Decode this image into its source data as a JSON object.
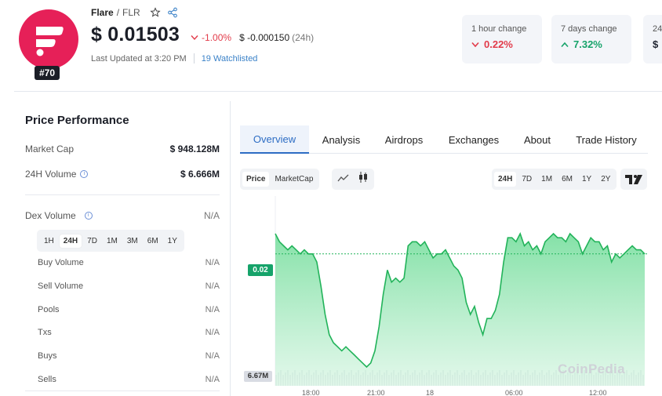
{
  "coin": {
    "name": "Flare",
    "separator": "/",
    "symbol": "FLR",
    "rank": "#70",
    "price": "$ 0.01503",
    "percent_change": "-1.00%",
    "abs_change": "$ -0.000150",
    "abs_change_period": "(24h)",
    "last_updated": "Last Updated at 3:20 PM",
    "watchlisted": "19 Watchlisted",
    "brand_color": "#e62058"
  },
  "stat_cards": [
    {
      "label": "1 hour change",
      "value": "0.22%",
      "direction": "down"
    },
    {
      "label": "7 days change",
      "value": "7.32%",
      "direction": "up"
    },
    {
      "label": "24",
      "value": "$",
      "direction": "none"
    }
  ],
  "performance": {
    "title": "Price Performance",
    "market_cap_label": "Market Cap",
    "market_cap_value": "$ 948.128M",
    "volume_label": "24H Volume",
    "volume_value": "$ 6.666M",
    "dex_label": "Dex Volume",
    "dex_value": "N/A",
    "ranges": [
      "1H",
      "24H",
      "7D",
      "1M",
      "3M",
      "6M",
      "1Y"
    ],
    "active_range": "24H",
    "rows": [
      {
        "label": "Buy Volume",
        "value": "N/A"
      },
      {
        "label": "Sell Volume",
        "value": "N/A"
      },
      {
        "label": "Pools",
        "value": "N/A"
      },
      {
        "label": "Txs",
        "value": "N/A"
      },
      {
        "label": "Buys",
        "value": "N/A"
      },
      {
        "label": "Sells",
        "value": "N/A"
      }
    ]
  },
  "tabs": [
    "Overview",
    "Analysis",
    "Airdrops",
    "Exchanges",
    "About",
    "Trade History"
  ],
  "active_tab": "Overview",
  "chart_mode": [
    "Price",
    "MarketCap"
  ],
  "active_chart_mode": "Price",
  "timeframes": [
    "24H",
    "7D",
    "1M",
    "6M",
    "1Y",
    "2Y"
  ],
  "active_timeframe": "24H",
  "watermark": "CoinPedia",
  "colors": {
    "accent": "#2d6dc4",
    "up": "#16a36a",
    "down": "#e23b4a"
  },
  "chart_data": {
    "type": "area",
    "current_price_label": "0.02",
    "volume_label": "6.67M",
    "x_ticks": [
      "18:00",
      "21:00",
      "18",
      "06:00",
      "12:00"
    ],
    "series": [
      {
        "values": [
          0.0155,
          0.0153,
          0.0152,
          0.0151,
          0.0152,
          0.0151,
          0.015,
          0.0151,
          0.015,
          0.015,
          0.0148,
          0.0142,
          0.0135,
          0.013,
          0.0128,
          0.0127,
          0.0126,
          0.0127,
          0.0126,
          0.0125,
          0.0124,
          0.0123,
          0.0122,
          0.0123,
          0.0126,
          0.0132,
          0.014,
          0.0146,
          0.0143,
          0.0144,
          0.0143,
          0.0144,
          0.0152,
          0.0153,
          0.0153,
          0.0152,
          0.0153,
          0.0151,
          0.0149,
          0.015,
          0.015,
          0.0151,
          0.0149,
          0.0147,
          0.0146,
          0.0144,
          0.0138,
          0.0135,
          0.0137,
          0.0133,
          0.013,
          0.0134,
          0.0134,
          0.0136,
          0.014,
          0.0148,
          0.0154,
          0.0154,
          0.0153,
          0.0155,
          0.0152,
          0.0153,
          0.0151,
          0.0152,
          0.015,
          0.0153,
          0.0154,
          0.0155,
          0.0154,
          0.0154,
          0.0153,
          0.0155,
          0.0154,
          0.0153,
          0.015,
          0.0152,
          0.0154,
          0.0153,
          0.0153,
          0.0151,
          0.0152,
          0.0148,
          0.015,
          0.0149,
          0.015,
          0.0151,
          0.0152,
          0.0151,
          0.0151,
          0.015
        ]
      }
    ]
  }
}
